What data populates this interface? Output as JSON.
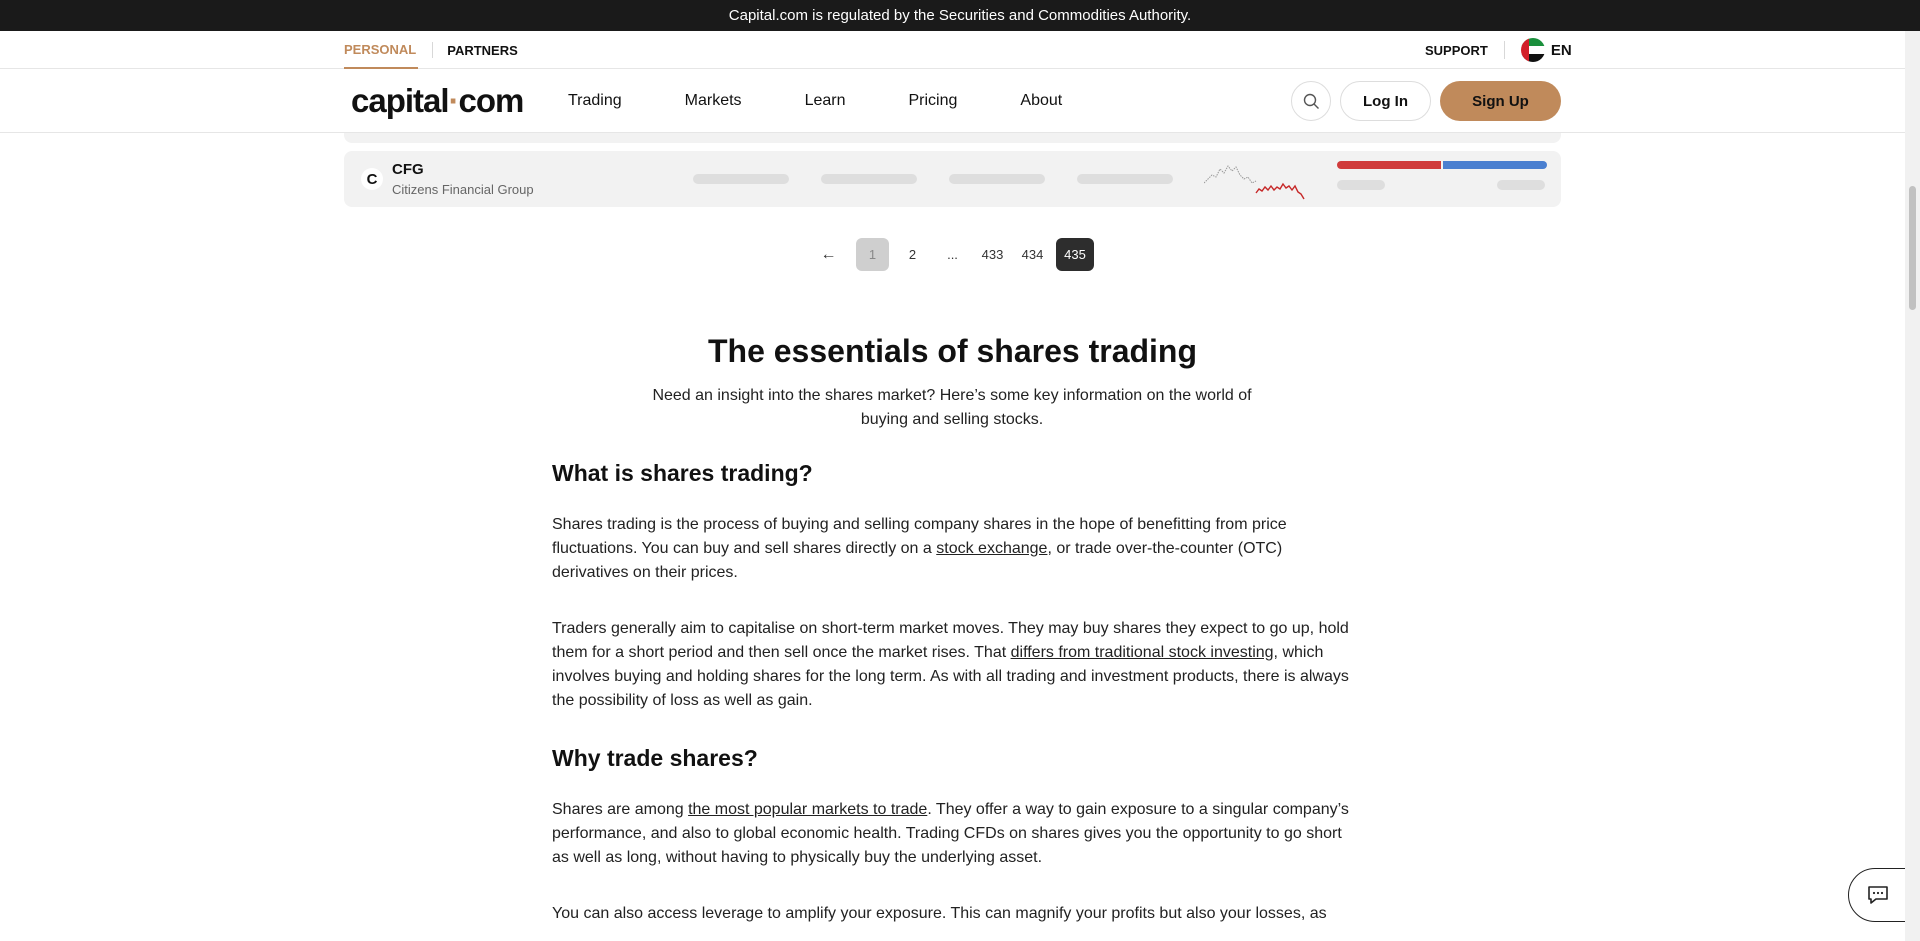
{
  "topbar": {
    "notice": "Capital.com is regulated by the Securities and Commodities Authority."
  },
  "subnav": {
    "personal": "PERSONAL",
    "partners": "PARTNERS",
    "support": "SUPPORT",
    "lang": "EN"
  },
  "header": {
    "logo": {
      "a": "capital",
      "b": "com"
    },
    "nav": [
      "Trading",
      "Markets",
      "Learn",
      "Pricing",
      "About"
    ],
    "login": "Log In",
    "signup": "Sign Up"
  },
  "table": {
    "row": {
      "icon": "c-logo",
      "ticker": "CFG",
      "name": "Citizens Financial Group"
    },
    "sentiment_colors": {
      "sell": "#d03b3b",
      "buy": "#4a7fd0"
    }
  },
  "pagination": {
    "prev": "←",
    "pages": [
      "1",
      "2",
      "...",
      "433",
      "434",
      "435"
    ],
    "current": "435"
  },
  "article": {
    "title": "The essentials of shares trading",
    "subtitle": "Need an insight into the shares market? Here’s some key information on the world of buying and selling stocks.",
    "sections": [
      {
        "heading": "What is shares trading?",
        "p1_pre": "Shares trading is the process of buying and selling company shares in the hope of benefitting from price fluctuations. You can buy and sell shares directly on a ",
        "p1_link": "stock exchange",
        "p1_post": ", or trade over-the-counter (OTC) derivatives on their prices.",
        "p2_pre": "Traders generally aim to capitalise on short-term market moves. They may buy shares they expect to go up, hold them for a short period and then sell once the market rises. That ",
        "p2_link": "differs from traditional stock investing",
        "p2_post": ", which involves buying and holding shares for the long term. As with all trading and investment products, there is always the possibility of loss as well as gain."
      },
      {
        "heading": "Why trade shares?",
        "p1_pre": "Shares are among ",
        "p1_link": "the most popular markets to trade",
        "p1_post": ". They offer a way to gain exposure to a singular company’s performance, and also to global economic health. Trading CFDs on shares gives you the opportunity to go short as well as long, without having to physically buy the underlying asset.",
        "p2": "You can also access leverage to amplify your exposure. This can magnify your profits but also your losses, as"
      }
    ]
  },
  "chat": {
    "icon": "chat-icon"
  },
  "accent": "#c08a5b"
}
